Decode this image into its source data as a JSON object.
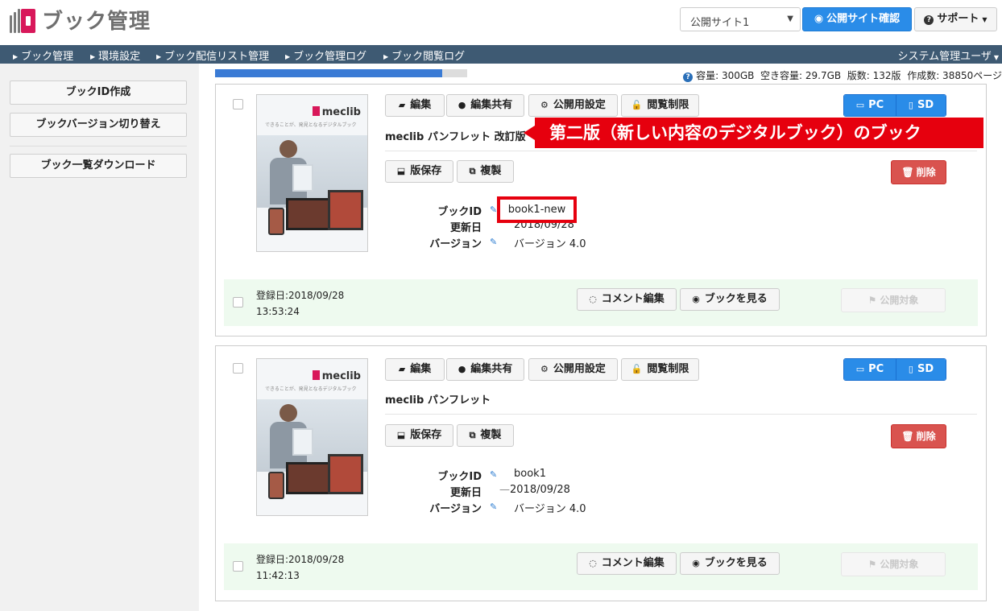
{
  "header": {
    "app_title": "ブック管理",
    "site_select_value": "公開サイト1",
    "confirm_site_label": "公開サイト確認",
    "support_label": "サポート"
  },
  "nav": {
    "items": [
      "ブック管理",
      "環境設定",
      "ブック配信リスト管理",
      "ブック管理ログ",
      "ブック閲覧ログ"
    ],
    "user_menu": "システム管理ユーザ"
  },
  "sidebar": {
    "create_id": "ブックID作成",
    "switch_version": "ブックバージョン切り替え",
    "download_list": "ブック一覧ダウンロード"
  },
  "storage": {
    "used_fraction": 0.9,
    "capacity_text": "容量: 300GB",
    "free_text": "空き容量: 29.7GB",
    "editions_text": "版数: 132版",
    "created_text": "作成数: 38850ページ"
  },
  "card_buttons": {
    "edit": "編集",
    "share": "編集共有",
    "public_settings": "公開用設定",
    "view_limit": "閲覧制限",
    "pc": "PC",
    "sd": "SD",
    "save_edition": "版保存",
    "copy": "複製",
    "delete": "削除",
    "comment": "コメント編集",
    "view_book": "ブックを見る",
    "publish_target": "公開対象"
  },
  "field_labels": {
    "book_id": "ブックID",
    "updated": "更新日",
    "version": "バージョン"
  },
  "cards": [
    {
      "title": "meclib パンフレット 改訂版",
      "book_id": "book1-new",
      "updated": "2018/09/28",
      "version": "バージョン 4.0",
      "reg_date": "登録日:2018/09/28",
      "reg_time": "13:53:24"
    },
    {
      "title": "meclib パンフレット",
      "book_id": "book1",
      "updated": "2018/09/28",
      "version": "バージョン 4.0",
      "reg_date": "登録日:2018/09/28",
      "reg_time": "11:42:13"
    }
  ],
  "thumbnail": {
    "brand": "meclib",
    "tagline": "できることが、発見となるデジタルブック"
  },
  "annotation": {
    "callout": "第二版（新しい内容のデジタルブック）のブック"
  },
  "colors": {
    "nav_bg": "#3e5a73",
    "primary": "#2a8ce8",
    "danger": "#d9534f",
    "annotation_red": "#e6000e",
    "footer_green": "#eefaef"
  }
}
